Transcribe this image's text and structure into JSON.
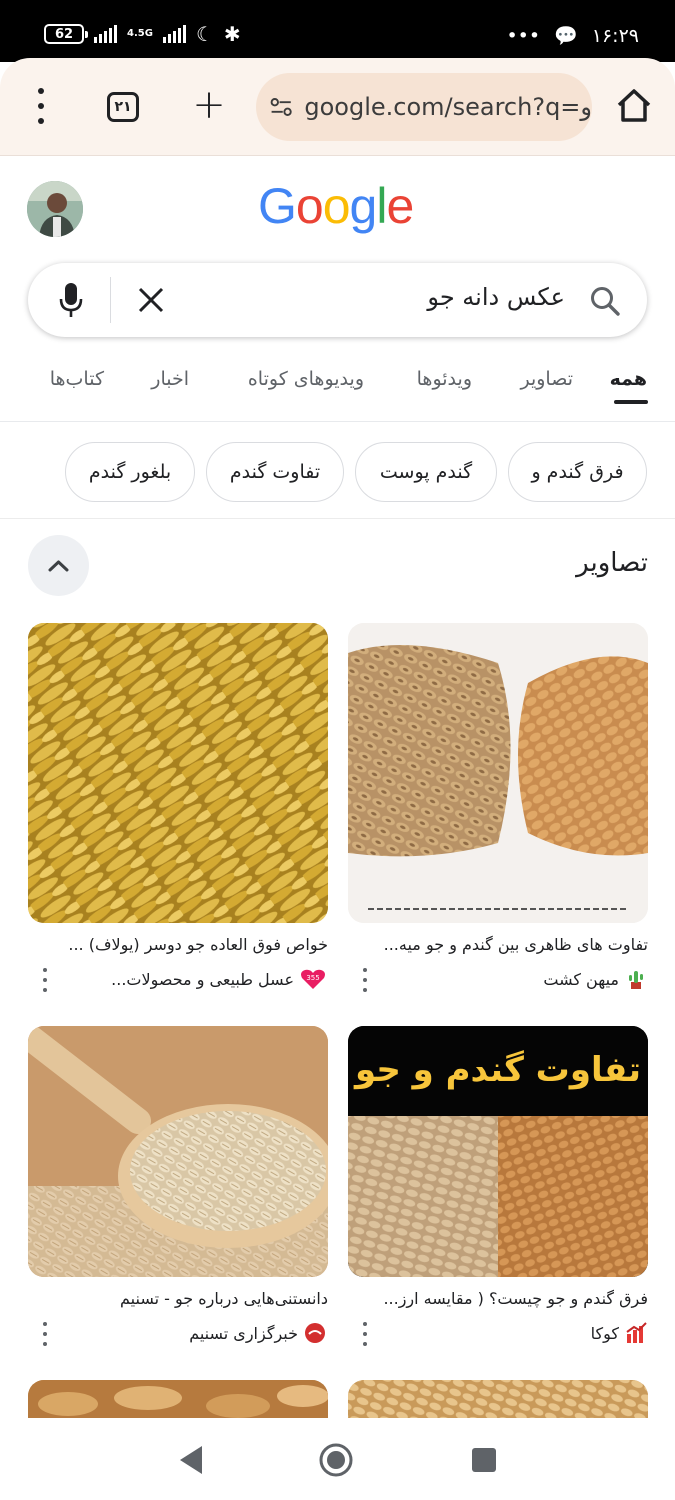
{
  "status_bar": {
    "battery": "62",
    "network": "4.5G",
    "dots": "•••",
    "time": "۱۶:۲۹"
  },
  "browser": {
    "tab_count": "۲۱",
    "url": "google.com/search?q=و"
  },
  "search": {
    "logo": "Google",
    "query": "عکس دانه جو"
  },
  "tabs": [
    {
      "label": "همه",
      "active": true
    },
    {
      "label": "تصاویر"
    },
    {
      "label": "ویدئوها"
    },
    {
      "label": "ویدیوهای کوتاه"
    },
    {
      "label": "اخبار"
    },
    {
      "label": "کتاب‌ها"
    }
  ],
  "chips": [
    "فرق گندم و",
    "گندم پوست",
    "تفاوت گندم",
    "بلغور گندم"
  ],
  "images_section": {
    "title": "تصاویر",
    "results": [
      {
        "caption": "تفاوت های ظاهری بین گندم و جو میه...",
        "source": "میهن کشت",
        "favicon": "cactus-icon",
        "image_text": ""
      },
      {
        "caption": "خواص فوق العاده جو دوسر (یولاف) ...",
        "source": "عسل طبیعی و محصولات...",
        "favicon": "355-heart-icon",
        "image_text": ""
      },
      {
        "caption": "فرق گندم و جو چیست؟ ( مقایسه ارز...",
        "source": "کوکا",
        "favicon": "chart-icon",
        "image_text": "تفاوت گندم و جو"
      },
      {
        "caption": "دانستنی‌هایی درباره جو - تسنیم",
        "source": "خبرگزاری تسنیم",
        "favicon": "tasnim-icon",
        "image_text": ""
      }
    ]
  },
  "colors": {
    "toolbar_bg": "#fbf3ed",
    "url_bg": "#f6e3d4",
    "google_blue": "#4285F4",
    "google_red": "#EA4335",
    "google_yellow": "#FBBC05",
    "google_green": "#34A853"
  }
}
